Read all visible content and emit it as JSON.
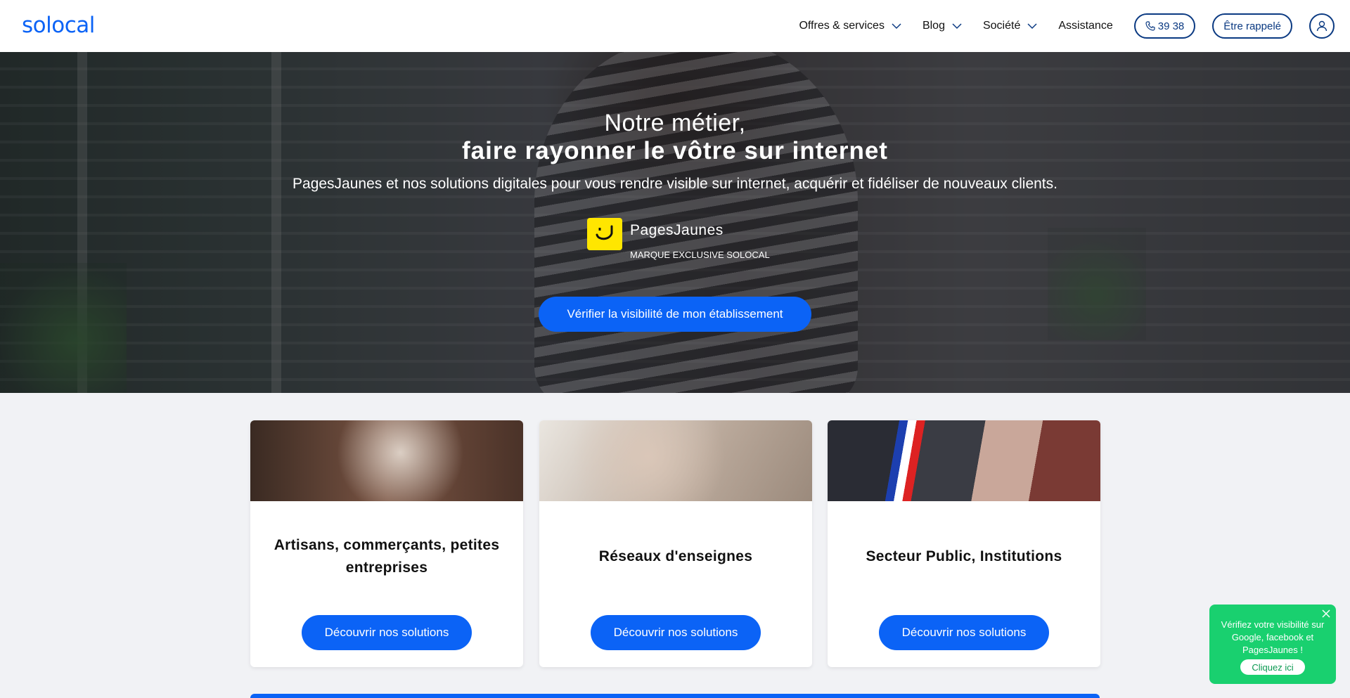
{
  "header": {
    "logo": "solocal",
    "nav": [
      {
        "label": "Offres & services",
        "dropdown": true
      },
      {
        "label": "Blog",
        "dropdown": true
      },
      {
        "label": "Société",
        "dropdown": true
      },
      {
        "label": "Assistance",
        "dropdown": false
      }
    ],
    "phone_label": "39 38",
    "callback_label": "Être rappelé",
    "user_icon": "user-icon"
  },
  "hero": {
    "title_line1": "Notre métier,",
    "title_line2": "faire rayonner le vôtre sur internet",
    "subtitle": "PagesJaunes et nos solutions digitales pour vous rendre visible sur internet, acquérir et fidéliser de nouveaux clients.",
    "brand_name": "PagesJaunes",
    "brand_tag": "MARQUE EXCLUSIVE SOLOCAL",
    "cta": "Vérifier la visibilité de mon établissement"
  },
  "cards": [
    {
      "title": "Artisans, commerçants, petites entreprises",
      "button": "Découvrir nos solutions"
    },
    {
      "title": "Réseaux d'enseignes",
      "button": "Découvrir nos solutions"
    },
    {
      "title": "Secteur Public, Institutions",
      "button": "Découvrir nos solutions"
    }
  ],
  "promo": {
    "text": "Vérifiez votre visibilité sur Google, facebook et PagesJaunes !",
    "button": "Cliquez ici"
  },
  "colors": {
    "brand_blue": "#0b63f6",
    "dark_blue": "#0b3a82",
    "promo_green": "#19d06f",
    "pj_yellow": "#ffe600"
  }
}
